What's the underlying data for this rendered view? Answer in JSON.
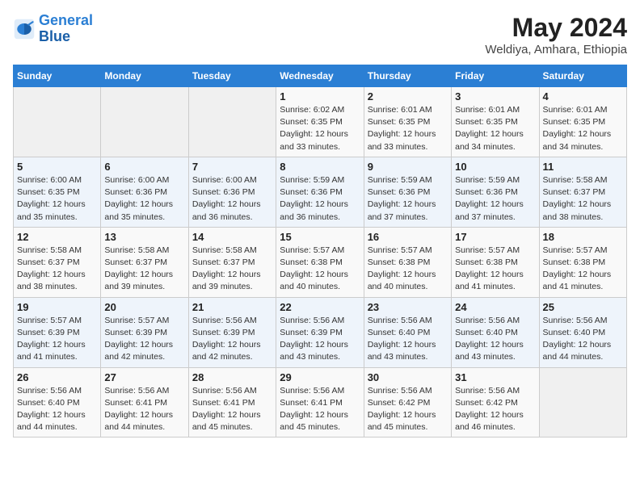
{
  "header": {
    "logo_line1": "General",
    "logo_line2": "Blue",
    "month_title": "May 2024",
    "location": "Weldiya, Amhara, Ethiopia"
  },
  "days_of_week": [
    "Sunday",
    "Monday",
    "Tuesday",
    "Wednesday",
    "Thursday",
    "Friday",
    "Saturday"
  ],
  "weeks": [
    [
      {
        "day": "",
        "info": ""
      },
      {
        "day": "",
        "info": ""
      },
      {
        "day": "",
        "info": ""
      },
      {
        "day": "1",
        "info": "Sunrise: 6:02 AM\nSunset: 6:35 PM\nDaylight: 12 hours\nand 33 minutes."
      },
      {
        "day": "2",
        "info": "Sunrise: 6:01 AM\nSunset: 6:35 PM\nDaylight: 12 hours\nand 33 minutes."
      },
      {
        "day": "3",
        "info": "Sunrise: 6:01 AM\nSunset: 6:35 PM\nDaylight: 12 hours\nand 34 minutes."
      },
      {
        "day": "4",
        "info": "Sunrise: 6:01 AM\nSunset: 6:35 PM\nDaylight: 12 hours\nand 34 minutes."
      }
    ],
    [
      {
        "day": "5",
        "info": "Sunrise: 6:00 AM\nSunset: 6:35 PM\nDaylight: 12 hours\nand 35 minutes."
      },
      {
        "day": "6",
        "info": "Sunrise: 6:00 AM\nSunset: 6:36 PM\nDaylight: 12 hours\nand 35 minutes."
      },
      {
        "day": "7",
        "info": "Sunrise: 6:00 AM\nSunset: 6:36 PM\nDaylight: 12 hours\nand 36 minutes."
      },
      {
        "day": "8",
        "info": "Sunrise: 5:59 AM\nSunset: 6:36 PM\nDaylight: 12 hours\nand 36 minutes."
      },
      {
        "day": "9",
        "info": "Sunrise: 5:59 AM\nSunset: 6:36 PM\nDaylight: 12 hours\nand 37 minutes."
      },
      {
        "day": "10",
        "info": "Sunrise: 5:59 AM\nSunset: 6:36 PM\nDaylight: 12 hours\nand 37 minutes."
      },
      {
        "day": "11",
        "info": "Sunrise: 5:58 AM\nSunset: 6:37 PM\nDaylight: 12 hours\nand 38 minutes."
      }
    ],
    [
      {
        "day": "12",
        "info": "Sunrise: 5:58 AM\nSunset: 6:37 PM\nDaylight: 12 hours\nand 38 minutes."
      },
      {
        "day": "13",
        "info": "Sunrise: 5:58 AM\nSunset: 6:37 PM\nDaylight: 12 hours\nand 39 minutes."
      },
      {
        "day": "14",
        "info": "Sunrise: 5:58 AM\nSunset: 6:37 PM\nDaylight: 12 hours\nand 39 minutes."
      },
      {
        "day": "15",
        "info": "Sunrise: 5:57 AM\nSunset: 6:38 PM\nDaylight: 12 hours\nand 40 minutes."
      },
      {
        "day": "16",
        "info": "Sunrise: 5:57 AM\nSunset: 6:38 PM\nDaylight: 12 hours\nand 40 minutes."
      },
      {
        "day": "17",
        "info": "Sunrise: 5:57 AM\nSunset: 6:38 PM\nDaylight: 12 hours\nand 41 minutes."
      },
      {
        "day": "18",
        "info": "Sunrise: 5:57 AM\nSunset: 6:38 PM\nDaylight: 12 hours\nand 41 minutes."
      }
    ],
    [
      {
        "day": "19",
        "info": "Sunrise: 5:57 AM\nSunset: 6:39 PM\nDaylight: 12 hours\nand 41 minutes."
      },
      {
        "day": "20",
        "info": "Sunrise: 5:57 AM\nSunset: 6:39 PM\nDaylight: 12 hours\nand 42 minutes."
      },
      {
        "day": "21",
        "info": "Sunrise: 5:56 AM\nSunset: 6:39 PM\nDaylight: 12 hours\nand 42 minutes."
      },
      {
        "day": "22",
        "info": "Sunrise: 5:56 AM\nSunset: 6:39 PM\nDaylight: 12 hours\nand 43 minutes."
      },
      {
        "day": "23",
        "info": "Sunrise: 5:56 AM\nSunset: 6:40 PM\nDaylight: 12 hours\nand 43 minutes."
      },
      {
        "day": "24",
        "info": "Sunrise: 5:56 AM\nSunset: 6:40 PM\nDaylight: 12 hours\nand 43 minutes."
      },
      {
        "day": "25",
        "info": "Sunrise: 5:56 AM\nSunset: 6:40 PM\nDaylight: 12 hours\nand 44 minutes."
      }
    ],
    [
      {
        "day": "26",
        "info": "Sunrise: 5:56 AM\nSunset: 6:40 PM\nDaylight: 12 hours\nand 44 minutes."
      },
      {
        "day": "27",
        "info": "Sunrise: 5:56 AM\nSunset: 6:41 PM\nDaylight: 12 hours\nand 44 minutes."
      },
      {
        "day": "28",
        "info": "Sunrise: 5:56 AM\nSunset: 6:41 PM\nDaylight: 12 hours\nand 45 minutes."
      },
      {
        "day": "29",
        "info": "Sunrise: 5:56 AM\nSunset: 6:41 PM\nDaylight: 12 hours\nand 45 minutes."
      },
      {
        "day": "30",
        "info": "Sunrise: 5:56 AM\nSunset: 6:42 PM\nDaylight: 12 hours\nand 45 minutes."
      },
      {
        "day": "31",
        "info": "Sunrise: 5:56 AM\nSunset: 6:42 PM\nDaylight: 12 hours\nand 46 minutes."
      },
      {
        "day": "",
        "info": ""
      }
    ]
  ]
}
